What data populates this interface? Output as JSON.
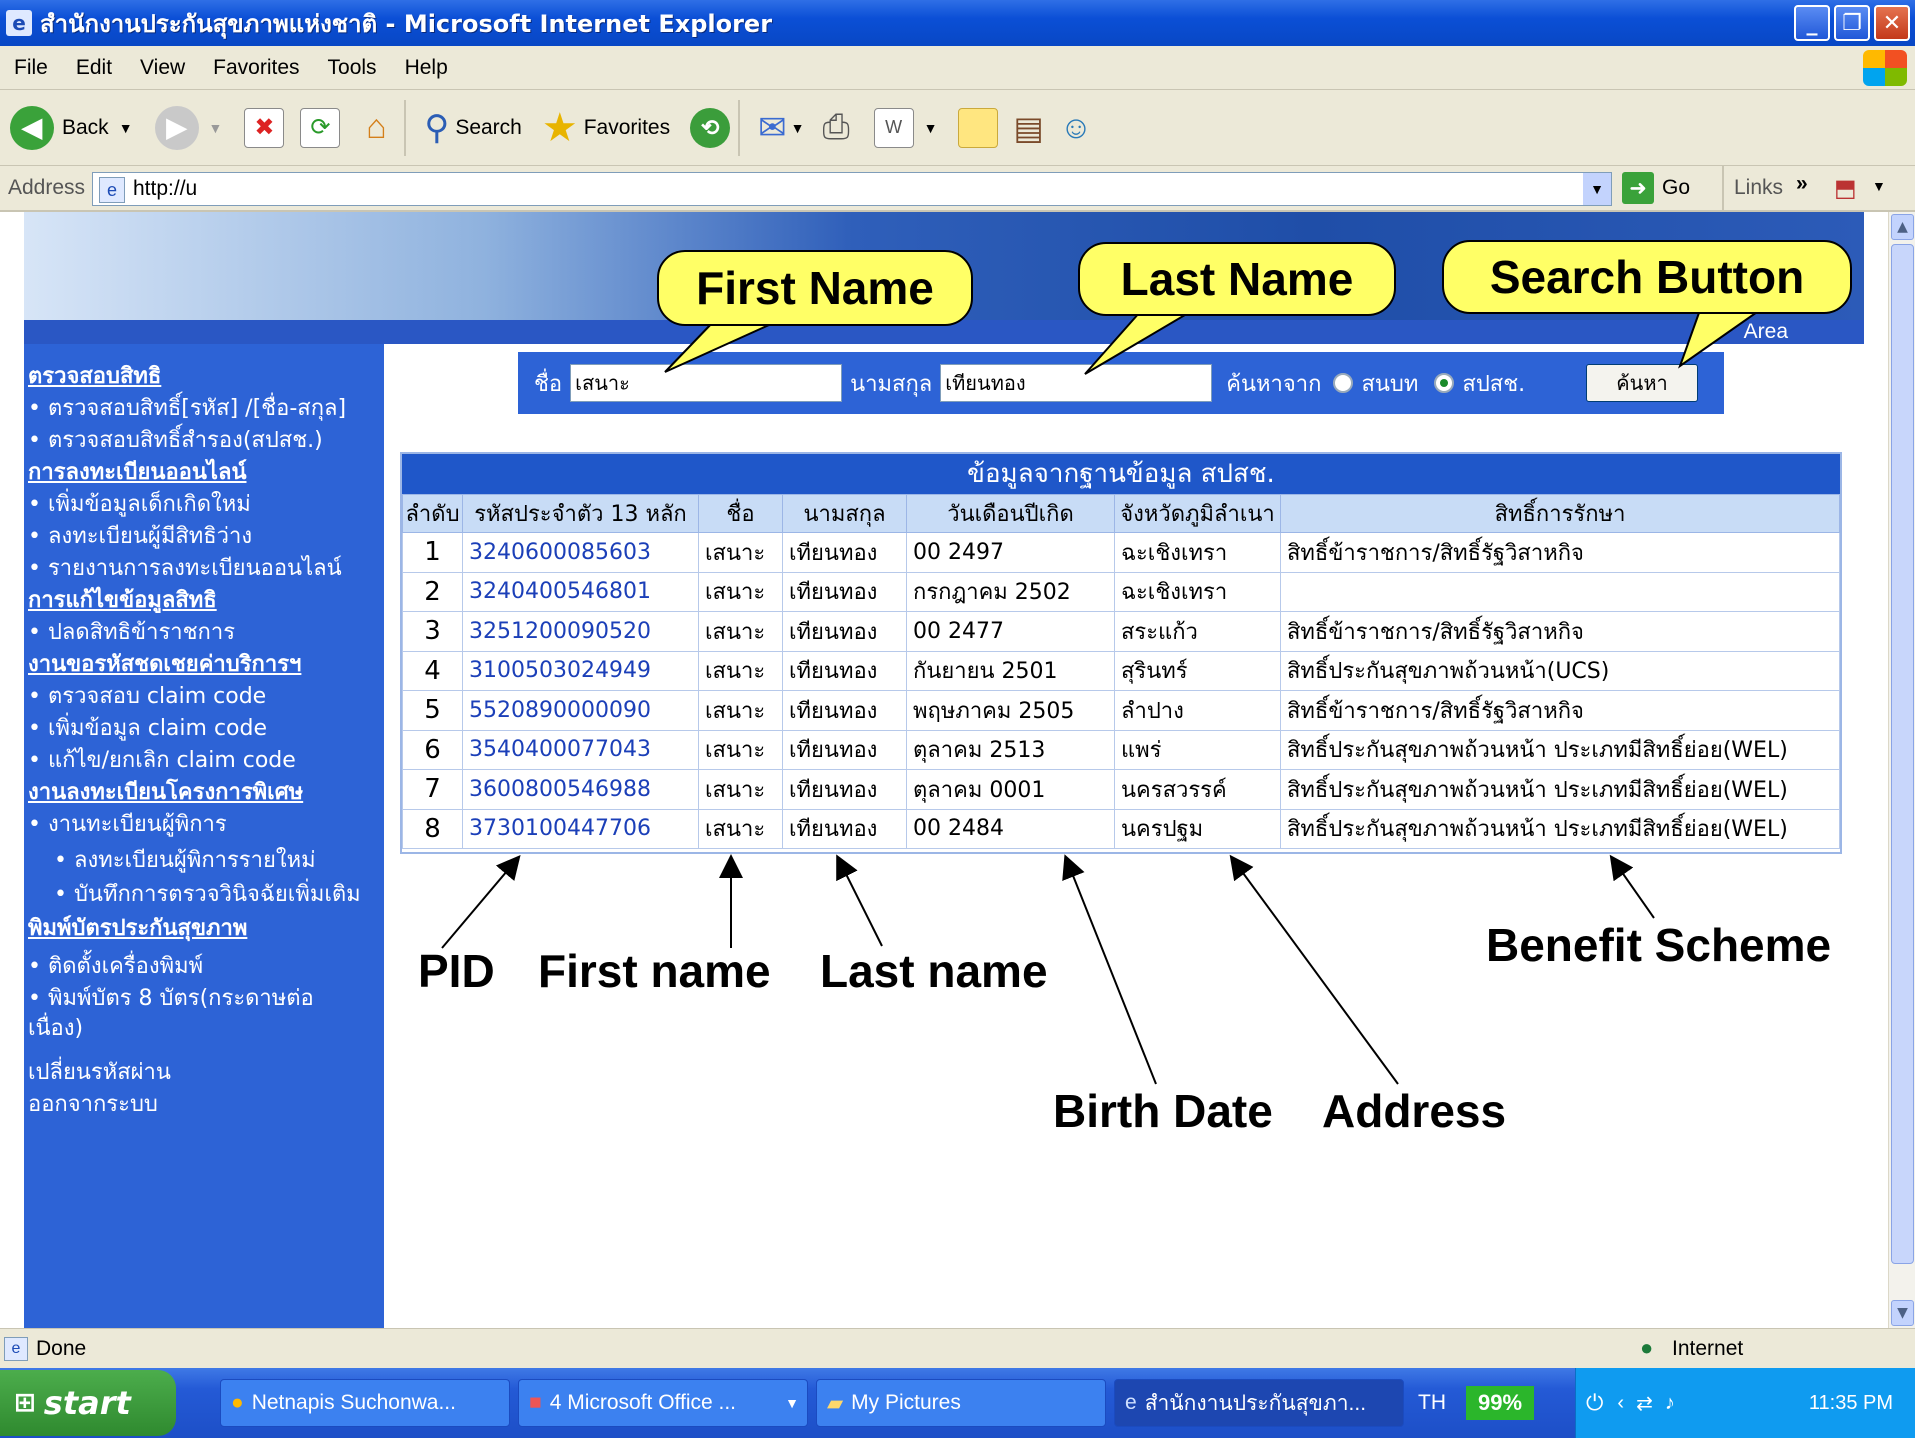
{
  "window": {
    "title": "สำนักงานประกันสุขภาพแห่งชาติ - Microsoft Internet Explorer"
  },
  "menu": [
    "File",
    "Edit",
    "View",
    "Favorites",
    "Tools",
    "Help"
  ],
  "toolbar": {
    "back": "Back",
    "search": "Search",
    "favorites": "Favorites"
  },
  "address": {
    "label": "Address",
    "value": "http://u",
    "go": "Go",
    "links": "Links"
  },
  "banner": {
    "area_text": "Area"
  },
  "sidebar": [
    {
      "text": "ตรวจสอบสิทธิ",
      "type": "head"
    },
    {
      "text": "• ตรวจสอบสิทธิ์[รหัส] /[ชื่อ-สกุล]",
      "type": "link"
    },
    {
      "text": "• ตรวจสอบสิทธิ์สำรอง(สปสช.)",
      "type": "link"
    },
    {
      "text": "การลงทะเบียนออนไลน์",
      "type": "head"
    },
    {
      "text": "• เพิ่มข้อมูลเด็กเกิดใหม่",
      "type": "link"
    },
    {
      "text": "• ลงทะเบียนผู้มีสิทธิว่าง",
      "type": "link"
    },
    {
      "text": "• รายงานการลงทะเบียนออนไลน์",
      "type": "link"
    },
    {
      "text": "การแก้ไขข้อมูลสิทธิ",
      "type": "head"
    },
    {
      "text": "• ปลดสิทธิข้าราชการ",
      "type": "link"
    },
    {
      "text": "งานขอรหัสชดเชยค่าบริการฯ",
      "type": "head"
    },
    {
      "text": "• ตรวจสอบ claim code",
      "type": "link"
    },
    {
      "text": "• เพิ่มข้อมูล claim code",
      "type": "link"
    },
    {
      "text": "• แก้ไข/ยกเลิก claim code",
      "type": "link"
    },
    {
      "text": "งานลงทะเบียนโครงการพิเศษ",
      "type": "head"
    },
    {
      "text": "• งานทะเบียนผู้พิการ",
      "type": "link"
    },
    {
      "text": "• ลงทะเบียนผู้พิการรายใหม่",
      "type": "sub"
    },
    {
      "text": "• บันทึกการตรวจวินิจฉัยเพิ่มเติม",
      "type": "sub"
    },
    {
      "text": "พิมพ์บัตรประกันสุขภาพ",
      "type": "head"
    },
    {
      "text": "• ติดตั้งเครื่องพิมพ์",
      "type": "link"
    },
    {
      "text": "• พิมพ์บัตร 8 บัตร(กระดาษต่อ",
      "type": "link"
    },
    {
      "text": "เนื่อง)",
      "type": "link"
    },
    {
      "text": "เปลี่ยนรหัสผ่าน",
      "type": "link"
    },
    {
      "text": "ออกจากระบบ",
      "type": "link"
    }
  ],
  "search": {
    "first_name_label": "ชื่อ",
    "first_name_value": "เสนาะ",
    "last_name_label": "นามสกุล",
    "last_name_value": "เทียนทอง",
    "search_from_label": "ค้นหาจาก",
    "option1": "สนบท",
    "option2": "สปสช.",
    "selected": "สปสช.",
    "button": "ค้นหา"
  },
  "results": {
    "caption": "ข้อมูลจากฐานข้อมูล สปสช.",
    "headers": [
      "ลำดับ",
      "รหัสประจำตัว 13 หลัก",
      "ชื่อ",
      "นามสกุล",
      "วันเดือนปีเกิด",
      "จังหวัดภูมิลำเนา",
      "สิทธิ์การรักษา"
    ],
    "rows": [
      [
        "1",
        "3240600085603",
        "เสนาะ",
        "เทียนทอง",
        "00  2497",
        "ฉะเชิงเทรา",
        "สิทธิ์ข้าราชการ/สิทธิ์รัฐวิสาหกิจ"
      ],
      [
        "2",
        "3240400546801",
        "เสนาะ",
        "เทียนทอง",
        "กรกฎาคม  2502",
        "ฉะเชิงเทรา",
        ""
      ],
      [
        "3",
        "3251200090520",
        "เสนาะ",
        "เทียนทอง",
        "00  2477",
        "สระแก้ว",
        "สิทธิ์ข้าราชการ/สิทธิ์รัฐวิสาหกิจ"
      ],
      [
        "4",
        "3100503024949",
        "เสนาะ",
        "เทียนทอง",
        "กันยายน  2501",
        "สุรินทร์",
        "สิทธิ์ประกันสุขภาพถ้วนหน้า(UCS)"
      ],
      [
        "5",
        "5520890000090",
        "เสนาะ",
        "เทียนทอง",
        "พฤษภาคม  2505",
        "ลำปาง",
        "สิทธิ์ข้าราชการ/สิทธิ์รัฐวิสาหกิจ"
      ],
      [
        "6",
        "3540400077043",
        "เสนาะ",
        "เทียนทอง",
        "ตุลาคม  2513",
        "แพร่",
        "สิทธิ์ประกันสุขภาพถ้วนหน้า ประเภทมีสิทธิ์ย่อย(WEL)"
      ],
      [
        "7",
        "3600800546988",
        "เสนาะ",
        "เทียนทอง",
        "ตุลาคม  0001",
        "นครสวรรค์",
        "สิทธิ์ประกันสุขภาพถ้วนหน้า ประเภทมีสิทธิ์ย่อย(WEL)"
      ],
      [
        "8",
        "3730100447706",
        "เสนาะ",
        "เทียนทอง",
        "00  2484",
        "นครปฐม",
        "สิทธิ์ประกันสุขภาพถ้วนหน้า ประเภทมีสิทธิ์ย่อย(WEL)"
      ]
    ]
  },
  "annotations": {
    "first_name": "First Name",
    "last_name": "Last Name",
    "search_button": "Search Button",
    "pid": "PID",
    "first_name_col": "First name",
    "last_name_col": "Last name",
    "birth_date": "Birth Date",
    "address": "Address",
    "benefit_scheme": "Benefit Scheme"
  },
  "statusbar": {
    "status": "Done",
    "zone": "Internet"
  },
  "taskbar": {
    "start": "start",
    "tasks": [
      "Netnapis Suchonwa...",
      "4 Microsoft Office ...",
      "My Pictures",
      "สำนักงานประกันสุขภา..."
    ],
    "lang": "TH",
    "battery": "99%",
    "clock": "11:35 PM"
  }
}
